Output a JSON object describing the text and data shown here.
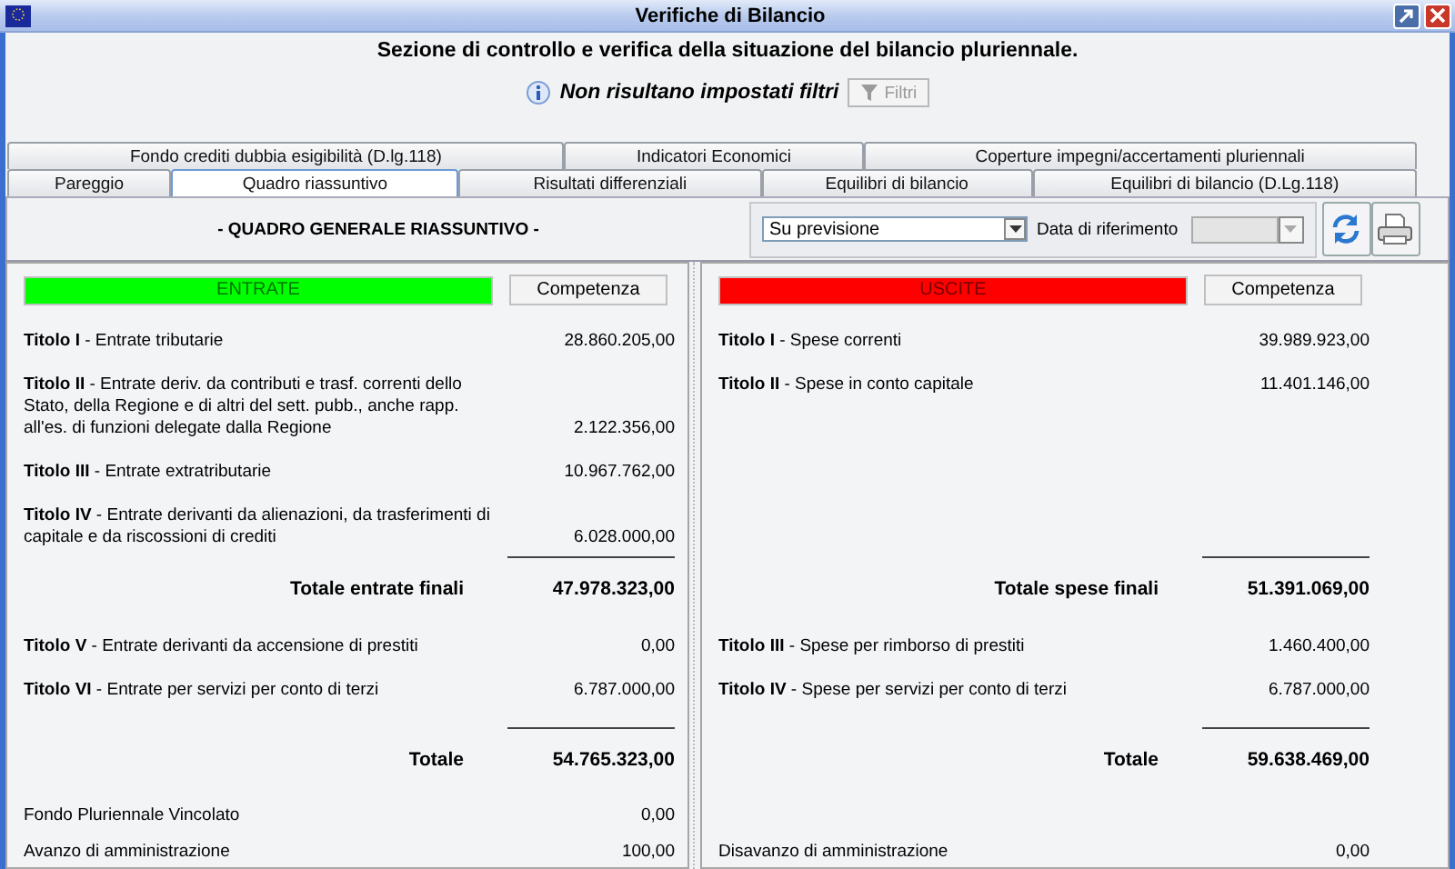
{
  "window": {
    "title": "Verifiche di Bilancio"
  },
  "header": {
    "heading": "Sezione di controllo e verifica della situazione del bilancio pluriennale.",
    "filter_notice": "Non risultano impostati filtri",
    "filter_button": {
      "label": "Filtri",
      "disabled": true
    }
  },
  "tab_rows": [
    [
      {
        "label": "Fondo crediti dubbia esigibilità (D.lg.118)",
        "selected": false
      },
      {
        "label": "Indicatori Economici",
        "selected": false
      },
      {
        "label": "Coperture impegni/accertamenti pluriennali",
        "selected": false
      }
    ],
    [
      {
        "label": "Pareggio",
        "selected": false
      },
      {
        "label": "Quadro riassuntivo",
        "selected": true
      },
      {
        "label": "Risultati differenziali",
        "selected": false
      },
      {
        "label": "Equilibri di bilancio",
        "selected": false
      },
      {
        "label": "Equilibri di bilancio (D.Lg.118)",
        "selected": false
      }
    ]
  ],
  "toolbar": {
    "section_title": "- QUADRO GENERALE RIASSUNTIVO -",
    "mode_select": {
      "value": "Su previsione"
    },
    "date_label": "Data di riferimento",
    "date_select": {
      "disabled": true
    }
  },
  "panels": [
    {
      "heading": "ENTRATE",
      "color": "#00ff00",
      "column_button": "Competenza",
      "groups": [
        {
          "items": [
            {
              "label": "**Titolo I** - Entrate tributarie",
              "amount": "28.860.205,00"
            },
            {
              "label": "**Titolo II** - Entrate deriv. da contributi e trasf. correnti dello Stato, della Regione e di altri del sett. pubb., anche rapp. all'es. di funzioni delegate dalla Regione",
              "amount": "2.122.356,00"
            },
            {
              "label": "**Titolo III** - Entrate extratributarie",
              "amount": "10.967.762,00"
            },
            {
              "label": "**Titolo IV** - Entrate derivanti da alienazioni, da trasferimenti di capitale e da riscossioni di crediti",
              "amount": "6.028.000,00"
            }
          ],
          "total": {
            "label": "Totale entrate finali",
            "amount": "47.978.323,00"
          }
        },
        {
          "items": [
            {
              "label": "**Titolo V** - Entrate derivanti da accensione di prestiti",
              "amount": "0,00"
            },
            {
              "label": "**Titolo VI** - Entrate per servizi per conto di terzi",
              "amount": "6.787.000,00"
            }
          ],
          "total": {
            "label": "Totale",
            "amount": "54.765.323,00"
          }
        }
      ],
      "other": [
        {
          "label": "Fondo Pluriennale Vincolato",
          "amount": "0,00"
        },
        {
          "label": "Avanzo di amministrazione",
          "amount": "100,00"
        }
      ]
    },
    {
      "heading": "USCITE",
      "color": "#ff0000",
      "column_button": "Competenza",
      "groups": [
        {
          "items": [
            {
              "label": "**Titolo I** - Spese correnti",
              "amount": "39.989.923,00"
            },
            {
              "label": "**Titolo II** - Spese in conto capitale",
              "amount": "11.401.146,00"
            }
          ],
          "total": {
            "label": "Totale spese finali",
            "amount": "51.391.069,00"
          }
        },
        {
          "items": [
            {
              "label": "**Titolo III** - Spese per rimborso di prestiti",
              "amount": "1.460.400,00"
            },
            {
              "label": "**Titolo IV** - Spese per servizi per conto di terzi",
              "amount": "6.787.000,00"
            }
          ],
          "total": {
            "label": "Totale",
            "amount": "59.638.469,00"
          }
        }
      ],
      "other": [
        {
          "label": "Disavanzo di amministrazione",
          "amount": "0,00"
        }
      ]
    }
  ]
}
